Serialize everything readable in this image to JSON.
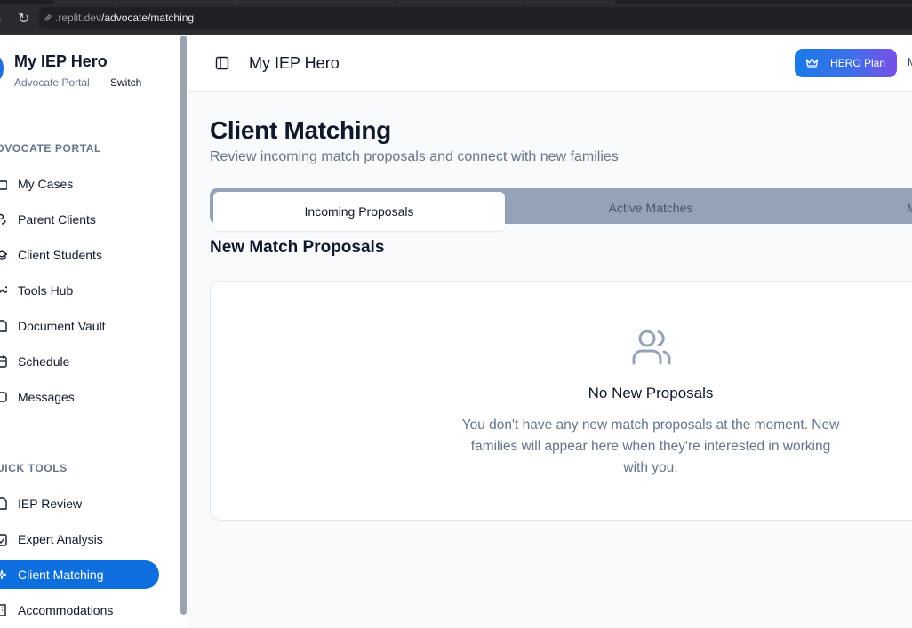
{
  "browser": {
    "url_host": ".replit.dev",
    "url_path": "/advocate/matching"
  },
  "sidebar": {
    "app_name": "My IEP Hero",
    "portal_label": "Advocate Portal",
    "switch_label": "Switch",
    "section_portal": "DVOCATE PORTAL",
    "portal_items": [
      {
        "label": "My Cases",
        "icon": "briefcase-icon"
      },
      {
        "label": "Parent Clients",
        "icon": "users-icon"
      },
      {
        "label": "Client Students",
        "icon": "graduation-cap-icon"
      },
      {
        "label": "Tools Hub",
        "icon": "wrench-icon"
      },
      {
        "label": "Document Vault",
        "icon": "file-icon"
      },
      {
        "label": "Schedule",
        "icon": "calendar-icon"
      },
      {
        "label": "Messages",
        "icon": "message-icon"
      }
    ],
    "section_tools": "UICK TOOLS",
    "tool_items": [
      {
        "label": "IEP Review",
        "icon": "file-text-icon"
      },
      {
        "label": "Expert Analysis",
        "icon": "clipboard-icon"
      },
      {
        "label": "Client Matching",
        "icon": "sparkle-icon",
        "active": true
      },
      {
        "label": "Accommodations",
        "icon": "building-icon"
      }
    ]
  },
  "header": {
    "title": "My IEP Hero",
    "plan_label": "HERO Plan",
    "cut_text": "M"
  },
  "page": {
    "title": "Client Matching",
    "subtitle": "Review incoming match proposals and connect with new families",
    "tabs": [
      {
        "label": "Incoming Proposals",
        "active": true
      },
      {
        "label": "Active Matches",
        "active": false
      },
      {
        "label": "M",
        "active": false
      }
    ],
    "section_title": "New Match Proposals",
    "empty": {
      "icon": "users-icon",
      "title": "No New Proposals",
      "description": "You don't have any new match proposals at the moment. New families will appear here when they're interested in working with you."
    }
  },
  "colors": {
    "accent": "#0d6fde",
    "plan_gradient_start": "#1a7ae6",
    "plan_gradient_end": "#7a4fe8",
    "tabs_bg": "#94a3b8",
    "muted_text": "#64748b"
  }
}
